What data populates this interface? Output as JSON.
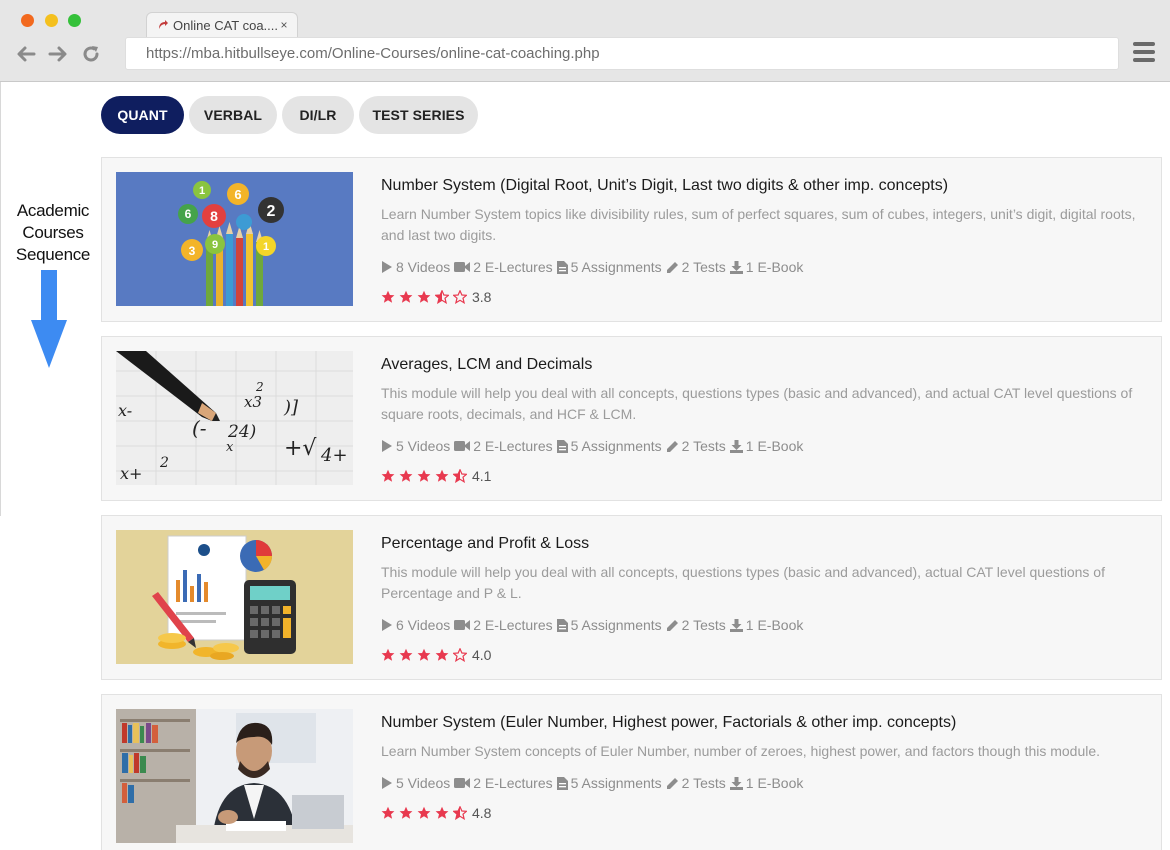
{
  "browser": {
    "tab_title": "Online CAT coa....",
    "tab_close": "×",
    "url": "https://mba.hitbullseye.com/Online-Courses/online-cat-coaching.php"
  },
  "annotation": {
    "line1": "Academic",
    "line2": "Courses",
    "line3": "Sequence"
  },
  "category_tabs": [
    {
      "label": "QUANT",
      "active": true
    },
    {
      "label": "VERBAL",
      "active": false
    },
    {
      "label": "DI/LR",
      "active": false
    },
    {
      "label": "TEST SERIES",
      "active": false
    }
  ],
  "courses": [
    {
      "title": "Number System (Digital Root, Unit’s Digit, Last two digits & other imp. concepts)",
      "description": "Learn Number System topics like divisibility rules, sum of perfect squares, sum of cubes, integers, unit’s digit, digital roots, and last two digits.",
      "videos": "8 Videos",
      "lectures": "2 E-Lectures",
      "assignments": "5 Assignments",
      "tests": "2 Tests",
      "ebook": "1 E-Book",
      "rating": "3.8",
      "rating_value": 3.5
    },
    {
      "title": "Averages, LCM and Decimals",
      "description": "This module will help you deal with all concepts, questions types (basic and advanced), and actual CAT level questions of square roots, decimals, and HCF & LCM.",
      "videos": "5 Videos",
      "lectures": "2 E-Lectures",
      "assignments": "5 Assignments",
      "tests": "2 Tests",
      "ebook": "1 E-Book",
      "rating": "4.1",
      "rating_value": 4.5
    },
    {
      "title": "Percentage and Profit & Loss",
      "description": "This module will help you deal with all concepts, questions types (basic and advanced), actual CAT level questions of Percentage and P & L.",
      "videos": "6 Videos",
      "lectures": "2 E-Lectures",
      "assignments": "5 Assignments",
      "tests": "2 Tests",
      "ebook": "1 E-Book",
      "rating": "4.0",
      "rating_value": 4
    },
    {
      "title": "Number System (Euler Number, Highest power, Factorials & other imp. concepts)",
      "description": "Learn Number System concepts of Euler Number, number of zeroes, highest power, and factors though this module.",
      "videos": "5 Videos",
      "lectures": "2 E-Lectures",
      "assignments": "5 Assignments",
      "tests": "2 Tests",
      "ebook": "1 E-Book",
      "rating": "4.8",
      "rating_value": 4.5
    }
  ],
  "colors": {
    "active_tab": "#0f1e5f",
    "star": "#e8394f",
    "arrow": "#3d8bf2"
  }
}
